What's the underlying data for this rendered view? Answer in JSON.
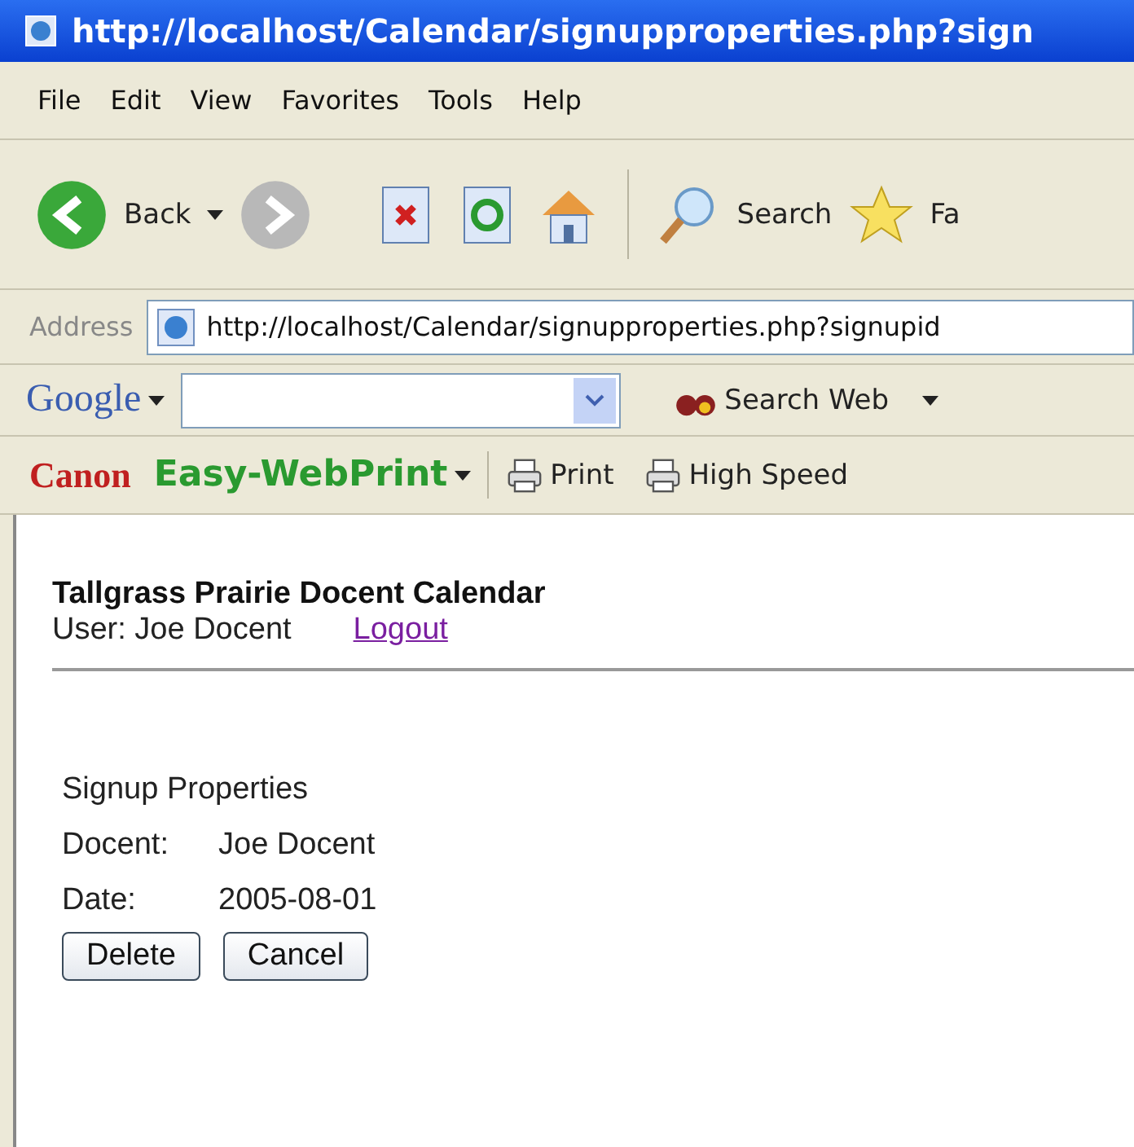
{
  "window": {
    "title": "http://localhost/Calendar/signupproperties.php?sign"
  },
  "menu": [
    "File",
    "Edit",
    "View",
    "Favorites",
    "Tools",
    "Help"
  ],
  "toolbar": {
    "back": "Back",
    "search": "Search",
    "favorites": "Fa"
  },
  "address": {
    "label": "Address",
    "value": "http://localhost/Calendar/signupproperties.php?signupid"
  },
  "google_bar": {
    "logo": "Google",
    "search_web": "Search Web"
  },
  "canon_bar": {
    "brand": "Canon",
    "product": "Easy-WebPrint",
    "print": "Print",
    "high_speed": "High Speed"
  },
  "page": {
    "heading": "Tallgrass Prairie Docent Calendar",
    "user": "User: Joe Docent",
    "logout": "Logout",
    "section": "Signup Properties",
    "fields": [
      {
        "label": "Docent:",
        "value": "Joe Docent"
      },
      {
        "label": "Date:",
        "value": "2005-08-01"
      }
    ],
    "buttons": [
      "Delete",
      "Cancel"
    ]
  }
}
